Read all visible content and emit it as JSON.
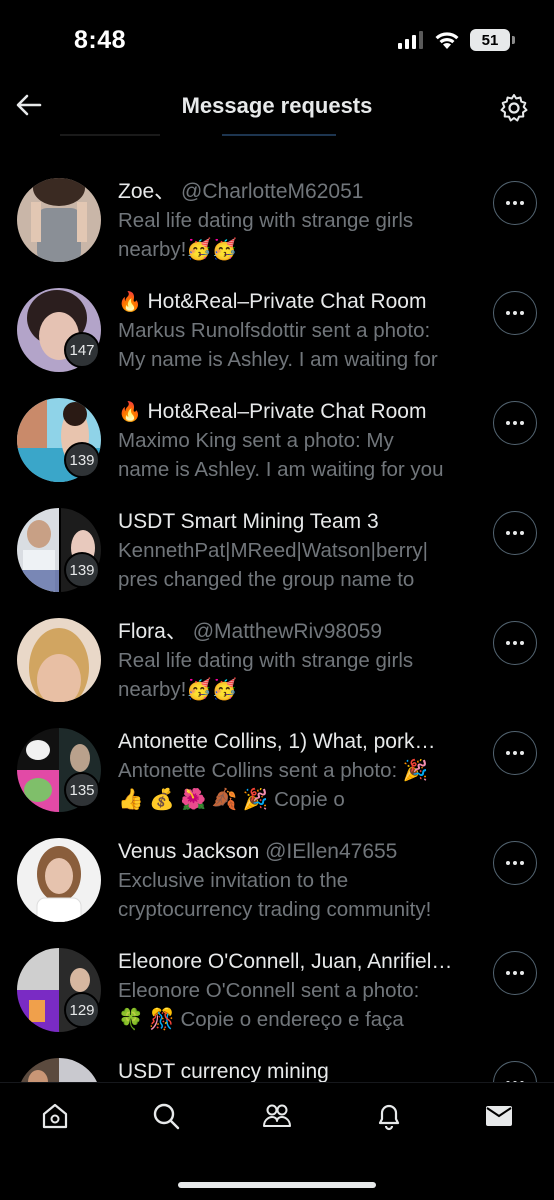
{
  "status_bar": {
    "time": "8:48",
    "battery": "51"
  },
  "header": {
    "title": "Message requests"
  },
  "conversations": [
    {
      "title_prefix": "",
      "name": "Zoe、",
      "handle": "@CharlotteM62051",
      "preview_line1": "Real life dating with strange girls",
      "preview_line2": "nearby!🥳🥳",
      "count": ""
    },
    {
      "title_prefix": "🔥",
      "name": "Hot&Real–Private Chat Room",
      "handle": "",
      "preview_line1": "Markus Runolfsdottir sent a photo:",
      "preview_line2": "My name is Ashley. I am waiting for",
      "count": "147"
    },
    {
      "title_prefix": "🔥",
      "name": "Hot&Real–Private Chat Room",
      "handle": "",
      "preview_line1": "Maximo King sent a photo: My",
      "preview_line2": "name is Ashley. I am waiting for you",
      "count": "139"
    },
    {
      "title_prefix": "",
      "name": "USDT Smart Mining Team 3",
      "handle": "",
      "preview_line1": "KennethPat|MReed|Watson|berry|",
      "preview_line2": "pres changed the group name to",
      "count": "139"
    },
    {
      "title_prefix": "",
      "name": "Flora、",
      "handle": "@MatthewRiv98059",
      "preview_line1": "Real life dating with strange girls",
      "preview_line2": "nearby!🥳🥳",
      "count": ""
    },
    {
      "title_prefix": "",
      "name": "Antonette Collins, 1) What, pork…",
      "handle": "",
      "preview_line1": "Antonette Collins sent a photo: 🎉",
      "preview_line2": "👍 💰 🌺 🍂 🎉 Copie o",
      "count": "135"
    },
    {
      "title_prefix": "",
      "name": "Venus Jackson",
      "handle": "@IEllen47655",
      "preview_line1": "Exclusive invitation to the",
      "preview_line2": "cryptocurrency trading community!",
      "count": ""
    },
    {
      "title_prefix": "",
      "name": "Eleonore O'Connell, Juan, Anrifiel…",
      "handle": "",
      "preview_line1": "Eleonore O'Connell sent a photo:",
      "preview_line2": "🍀 🎊 Copie o endereço e faça",
      "count": "129"
    },
    {
      "title_prefix": "",
      "name": "USDT currency mining",
      "handle": "",
      "preview_line1": "",
      "preview_line2": "",
      "count": ""
    }
  ],
  "nav": [
    "home-icon",
    "search-icon",
    "communities-icon",
    "notifications-icon",
    "messages-icon"
  ],
  "colors": {
    "background": "#000000",
    "primary_text": "#e7e9ea",
    "secondary_text": "#71767b",
    "border": "#536471"
  }
}
